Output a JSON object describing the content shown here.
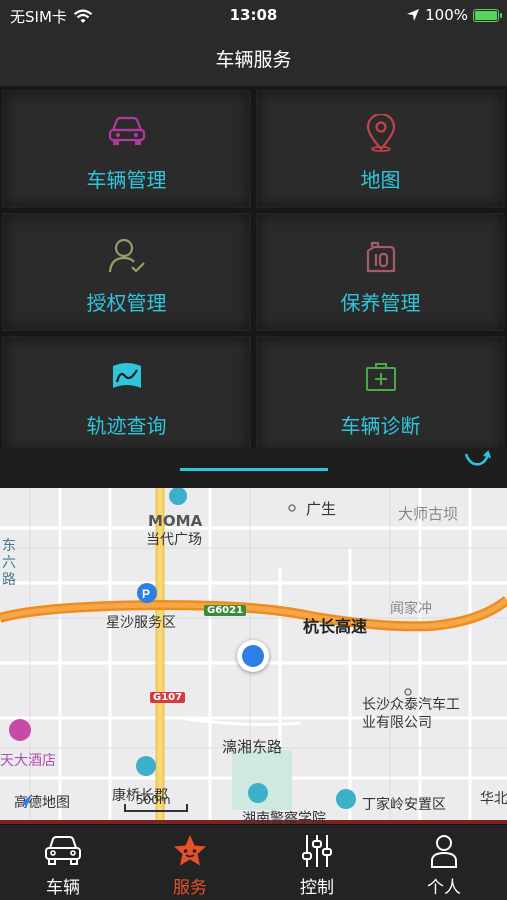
{
  "status": {
    "carrier": "无SIM卡",
    "time": "13:08",
    "battery": "100%"
  },
  "header": {
    "title": "车辆服务"
  },
  "grid": {
    "items": [
      {
        "label": "车辆管理",
        "icon": "car-icon",
        "color": "#b03aa0"
      },
      {
        "label": "地图",
        "icon": "map-pin-icon",
        "color": "#c0454a"
      },
      {
        "label": "授权管理",
        "icon": "user-check-icon",
        "color": "#9a9a6a"
      },
      {
        "label": "保养管理",
        "icon": "oil-can-icon",
        "color": "#a85a6a"
      },
      {
        "label": "轨迹查询",
        "icon": "track-map-icon",
        "color": "#2fc6dc"
      },
      {
        "label": "车辆诊断",
        "icon": "first-aid-kit-icon",
        "color": "#4aa84a"
      }
    ]
  },
  "map": {
    "labels": {
      "moma": "MOMA",
      "dangdai": "当代广场",
      "guangsheng": "广生",
      "dashi": "大师古坝",
      "dongliu": "东六路",
      "xingsha": "星沙服务区",
      "hangchang": "杭长高速",
      "wenjia": "闻家冲",
      "zhongtai": "长沙众泰汽车工业有限公司",
      "hotel": "天大酒店",
      "lixiang": "漓湘东路",
      "kangqiao": "康桥长郡",
      "police": "湖南警察学院",
      "dingjia": "丁家岭安置区",
      "huabei": "华北",
      "brand": "高德地图",
      "scale": "500m",
      "g6021": "G6021",
      "g107": "G107"
    }
  },
  "tabs": [
    {
      "label": "车辆",
      "icon": "car-icon"
    },
    {
      "label": "服务",
      "icon": "star-icon"
    },
    {
      "label": "控制",
      "icon": "sliders-icon"
    },
    {
      "label": "个人",
      "icon": "person-icon"
    }
  ]
}
